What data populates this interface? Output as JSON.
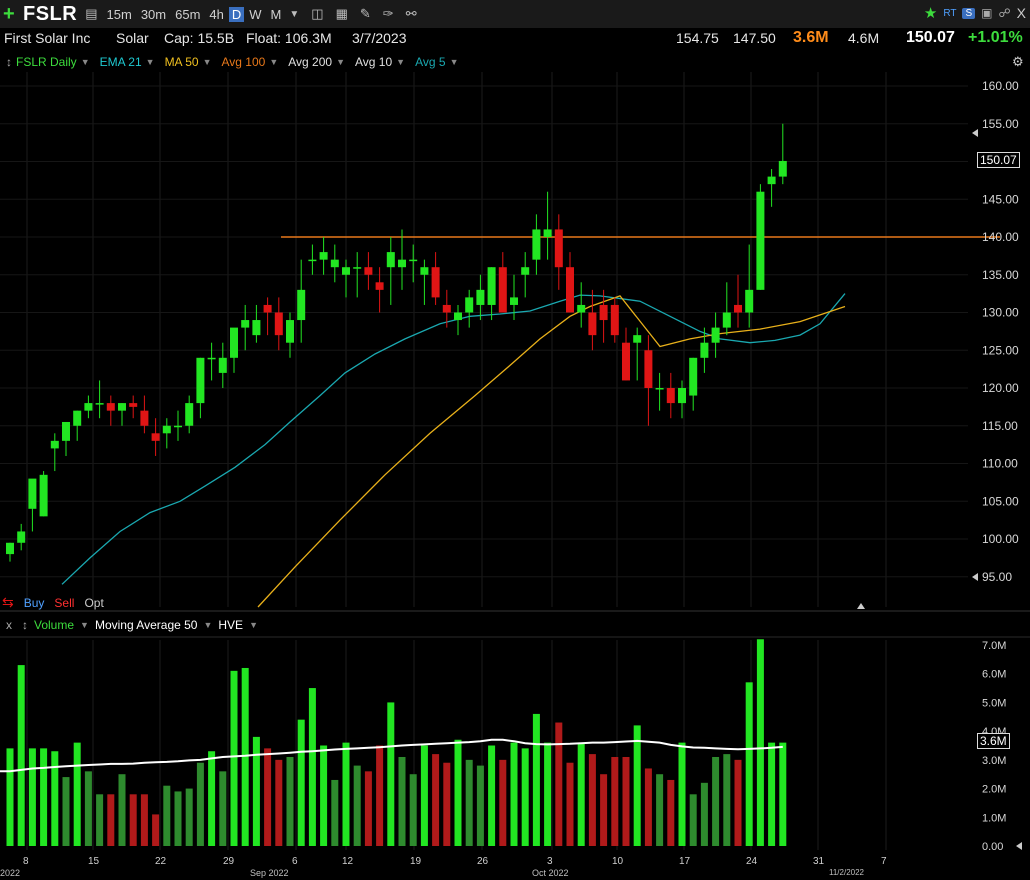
{
  "toolbar": {
    "plus": "+",
    "ticker": "FSLR",
    "timeframes": [
      "15m",
      "30m",
      "65m",
      "4h",
      "D",
      "W",
      "M"
    ],
    "active_timeframe": "D",
    "rt_label": "RT",
    "s_label": "S",
    "close": "X"
  },
  "info": {
    "company": "First Solar Inc",
    "sector": "Solar",
    "cap": "Cap: 15.5B",
    "float": "Float: 106.3M",
    "date": "3/7/2023",
    "high": "154.75",
    "low": "147.50",
    "volume": "3.6M",
    "avg_volume": "4.6M",
    "last": "150.07",
    "change_pct": "+1.01%"
  },
  "legend": {
    "symbol": "FSLR Daily",
    "ema21": "EMA 21",
    "ma50": "MA 50",
    "avg100": "Avg 100",
    "avg200": "Avg 200",
    "avg10": "Avg 10",
    "avg5": "Avg 5"
  },
  "orders": {
    "buy": "Buy",
    "sell": "Sell",
    "opt": "Opt"
  },
  "volume_legend": {
    "close": "x",
    "volume": "Volume",
    "ma": "Moving Average 50",
    "hve": "HVE"
  },
  "price_axis": [
    "160.00",
    "155.00",
    "150.00",
    "145.00",
    "140.00",
    "135.00",
    "130.00",
    "125.00",
    "120.00",
    "115.00",
    "110.00",
    "105.00",
    "100.00",
    "95.00"
  ],
  "price_tag": "150.07",
  "volume_axis": [
    "7.0M",
    "6.0M",
    "5.0M",
    "4.0M",
    "3.0M",
    "2.0M",
    "1.0M",
    "0.00"
  ],
  "volume_tag": "3.6M",
  "x_day_labels": [
    "8",
    "15",
    "22",
    "29",
    "6",
    "12",
    "19",
    "26",
    "3",
    "10",
    "17",
    "24",
    "31",
    "7"
  ],
  "x_month_labels": [
    "2022",
    "Sep 2022",
    "Oct 2022",
    "11/2/2022"
  ],
  "colors": {
    "up": "#22e622",
    "down": "#e01515",
    "ema21": "#1aa8b0",
    "ma50": "#e8b01a",
    "resistance": "#e8781a",
    "vol_up_bright": "#22e622",
    "vol_up_dark": "#2e8b2e",
    "vol_down": "#b01a1a",
    "vol_ma": "#ffffff"
  },
  "resistance_level": 140,
  "chart_data": {
    "type": "candlestick",
    "candles": [
      [
        98.0,
        99.5,
        97.0,
        99.5
      ],
      [
        99.5,
        102,
        98.5,
        101
      ],
      [
        104,
        107,
        101,
        108
      ],
      [
        103,
        109,
        103,
        108.5
      ],
      [
        112,
        114,
        109,
        113
      ],
      [
        113,
        115,
        111,
        115.5
      ],
      [
        115,
        117,
        113,
        117
      ],
      [
        117,
        119,
        116,
        118
      ],
      [
        118,
        121,
        116,
        118
      ],
      [
        118,
        119,
        115,
        117
      ],
      [
        117,
        118,
        115,
        118
      ],
      [
        118,
        119,
        116,
        117.5
      ],
      [
        117,
        119,
        114,
        115
      ],
      [
        114,
        116,
        111,
        113
      ],
      [
        114,
        116,
        112,
        115
      ],
      [
        115,
        117,
        113,
        115
      ],
      [
        115,
        119,
        114,
        118
      ],
      [
        118,
        124,
        116,
        124
      ],
      [
        124,
        126,
        121,
        124
      ],
      [
        122,
        126,
        120,
        124
      ],
      [
        124,
        127,
        122,
        128
      ],
      [
        128,
        131,
        125,
        129
      ],
      [
        127,
        131,
        126,
        129
      ],
      [
        131,
        132,
        127,
        130
      ],
      [
        130,
        132,
        125,
        127
      ],
      [
        126,
        130,
        124,
        129
      ],
      [
        129,
        137,
        126,
        133
      ],
      [
        137,
        139,
        135,
        137
      ],
      [
        137,
        140,
        135,
        138
      ],
      [
        136,
        139,
        134,
        137
      ],
      [
        135,
        137,
        132,
        136
      ],
      [
        136,
        138,
        132,
        136
      ],
      [
        136,
        138,
        133,
        135
      ],
      [
        134,
        136,
        130,
        133
      ],
      [
        136,
        140,
        131,
        138
      ],
      [
        136,
        141,
        133,
        137
      ],
      [
        137,
        139,
        134,
        137
      ],
      [
        135,
        137,
        131,
        136
      ],
      [
        136,
        138,
        131,
        132
      ],
      [
        131,
        133,
        128,
        130
      ],
      [
        129,
        131,
        127,
        130
      ],
      [
        130,
        133,
        128,
        132
      ],
      [
        131,
        135,
        129,
        133
      ],
      [
        131,
        136,
        129,
        136
      ],
      [
        136,
        138,
        131,
        130
      ],
      [
        131,
        135,
        129,
        132
      ],
      [
        135,
        138,
        132,
        136
      ],
      [
        137,
        143,
        135,
        141
      ],
      [
        140,
        146,
        137,
        141
      ],
      [
        141,
        143,
        133,
        136
      ],
      [
        136,
        138,
        131,
        130
      ],
      [
        130,
        134,
        128,
        131
      ],
      [
        130,
        133,
        125,
        127
      ],
      [
        131,
        133,
        126,
        129
      ],
      [
        131,
        132,
        126,
        127
      ],
      [
        126,
        128,
        121,
        121
      ],
      [
        126,
        128,
        121,
        127
      ],
      [
        125,
        127,
        115,
        120
      ],
      [
        120,
        122,
        117,
        120
      ],
      [
        120,
        122,
        116,
        118
      ],
      [
        118,
        121,
        116,
        120
      ],
      [
        119,
        124,
        117,
        124
      ],
      [
        124,
        128,
        122,
        126
      ],
      [
        126,
        130,
        124,
        128
      ],
      [
        128,
        134,
        127,
        130
      ],
      [
        131,
        135,
        128,
        130
      ],
      [
        130,
        139,
        128,
        133
      ],
      [
        133,
        147,
        133,
        146
      ],
      [
        147,
        149,
        144,
        148
      ],
      [
        148,
        155,
        147,
        150.07
      ]
    ],
    "volume": [
      3.4,
      6.3,
      3.4,
      3.4,
      3.3,
      2.4,
      3.6,
      2.6,
      1.8,
      1.8,
      2.5,
      1.8,
      1.8,
      1.1,
      2.1,
      1.9,
      2.0,
      2.9,
      3.3,
      2.6,
      6.1,
      6.2,
      3.8,
      3.4,
      3.0,
      3.1,
      4.4,
      5.5,
      3.5,
      2.3,
      3.6,
      2.8,
      2.6,
      3.5,
      5.0,
      3.1,
      2.5,
      3.5,
      3.2,
      2.9,
      3.7,
      3.0,
      2.8,
      3.5,
      3.0,
      3.6,
      3.4,
      4.6,
      3.6,
      4.3,
      2.9,
      3.6,
      3.2,
      2.5,
      3.1,
      3.1,
      4.2,
      2.7,
      2.5,
      2.3,
      3.6,
      1.8,
      2.2,
      3.1,
      3.2,
      3.0,
      5.7,
      7.2,
      3.6,
      3.6
    ],
    "volume_ma": [
      2.6,
      2.65,
      2.7,
      2.72,
      2.75,
      2.78,
      2.8,
      2.82,
      2.84,
      2.86,
      2.86,
      2.87,
      2.9,
      2.92,
      2.93,
      2.95,
      2.98,
      3.0,
      3.05,
      3.1,
      3.12,
      3.14,
      3.18,
      3.2,
      3.22,
      3.25,
      3.28,
      3.3,
      3.33,
      3.36,
      3.38,
      3.4,
      3.42,
      3.44,
      3.47,
      3.5,
      3.52,
      3.54,
      3.56,
      3.58,
      3.6,
      3.62,
      3.65,
      3.7,
      3.7,
      3.65,
      3.58,
      3.55,
      3.54,
      3.55,
      3.56,
      3.58,
      3.6,
      3.6,
      3.62,
      3.64,
      3.66,
      3.63,
      3.6,
      3.52,
      3.47,
      3.43,
      3.42,
      3.4,
      3.38,
      3.37,
      3.38,
      3.4,
      3.42,
      3.45
    ],
    "ema21": [
      [
        62,
        94
      ],
      [
        90,
        97.5
      ],
      [
        120,
        101
      ],
      [
        150,
        103.5
      ],
      [
        180,
        105
      ],
      [
        205,
        107
      ],
      [
        235,
        109.5
      ],
      [
        265,
        112.5
      ],
      [
        290,
        115.5
      ],
      [
        320,
        119
      ],
      [
        345,
        122
      ],
      [
        375,
        124.5
      ],
      [
        405,
        126.5
      ],
      [
        440,
        128.5
      ],
      [
        470,
        129.5
      ],
      [
        500,
        129.8
      ],
      [
        530,
        130.2
      ],
      [
        560,
        131.5
      ],
      [
        580,
        132.3
      ],
      [
        600,
        132.2
      ],
      [
        640,
        131.5
      ],
      [
        670,
        129.5
      ],
      [
        700,
        127.5
      ],
      [
        720,
        126.5
      ],
      [
        750,
        126
      ],
      [
        775,
        126.3
      ],
      [
        800,
        127
      ],
      [
        820,
        128.5
      ],
      [
        845,
        132.5
      ]
    ],
    "ma50": [
      [
        258,
        91
      ],
      [
        295,
        96.3
      ],
      [
        340,
        102.5
      ],
      [
        385,
        108.5
      ],
      [
        430,
        114
      ],
      [
        475,
        119
      ],
      [
        510,
        123
      ],
      [
        540,
        126.5
      ],
      [
        570,
        129.5
      ],
      [
        590,
        130.8
      ],
      [
        620,
        132.2
      ],
      [
        660,
        125.5
      ],
      [
        690,
        126.5
      ],
      [
        720,
        127.2
      ],
      [
        760,
        127.8
      ],
      [
        800,
        128.8
      ],
      [
        845,
        130.8
      ]
    ],
    "ylim": [
      90,
      163
    ],
    "volume_ylim": [
      0,
      7.5
    ]
  }
}
